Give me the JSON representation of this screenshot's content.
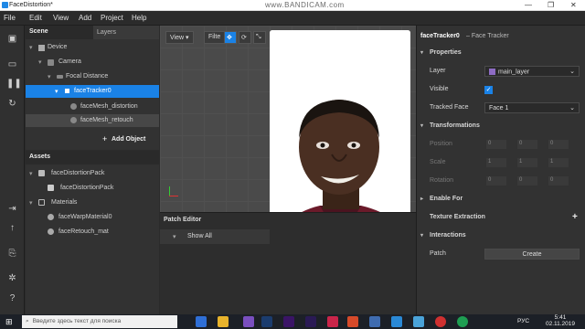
{
  "window": {
    "title": "FaceDistortion*",
    "watermark": "www.BANDICAM.com"
  },
  "menu": [
    "File",
    "Edit",
    "View",
    "Add",
    "Project",
    "Help"
  ],
  "scene": {
    "header": "Scene",
    "tab_layers": "Layers",
    "items": [
      {
        "label": "Device",
        "indent": 0
      },
      {
        "label": "Camera",
        "indent": 1
      },
      {
        "label": "Focal Distance",
        "indent": 2
      },
      {
        "label": "faceTracker0",
        "indent": 3,
        "selected": true
      },
      {
        "label": "faceMesh_distortion",
        "indent": 4
      },
      {
        "label": "faceMesh_retouch",
        "indent": 4
      }
    ],
    "add_object": "Add Object"
  },
  "assets": {
    "header": "Assets",
    "items": [
      {
        "label": "faceDistortionPack",
        "indent": 0
      },
      {
        "label": "faceDistortionPack",
        "indent": 1
      },
      {
        "label": "Materials",
        "indent": 0
      },
      {
        "label": "faceWarpMaterial0",
        "indent": 1
      },
      {
        "label": "faceRetouch_mat",
        "indent": 1
      }
    ]
  },
  "viewport": {
    "view_label": "View",
    "filter_label": "Filte"
  },
  "patch_editor": {
    "header": "Patch Editor",
    "show": "Show All"
  },
  "inspector": {
    "title": "faceTracker0",
    "subtitle": "– Face Tracker",
    "properties": "Properties",
    "layer_label": "Layer",
    "layer_value": "main_layer",
    "visible_label": "Visible",
    "visible_checked": true,
    "tracked_label": "Tracked Face",
    "tracked_value": "Face 1",
    "transformations": "Transformations",
    "position": "Position",
    "scale": "Scale",
    "rotation": "Rotation",
    "pos_vals": [
      "0",
      "0",
      "0"
    ],
    "scale_vals": [
      "1",
      "1",
      "1"
    ],
    "rot_vals": [
      "0",
      "0",
      "0"
    ],
    "enable_for": "Enable For",
    "texture": "Texture Extraction",
    "interactions": "Interactions",
    "patch_label": "Patch",
    "create": "Create"
  },
  "taskbar": {
    "search_placeholder": "Введите здесь текст для поиска",
    "lang": "РУС",
    "time": "5:41",
    "date": "02.11.2019"
  },
  "colors": {
    "accent": "#1a82e6",
    "layer_swatch": "#8e6cc4"
  }
}
